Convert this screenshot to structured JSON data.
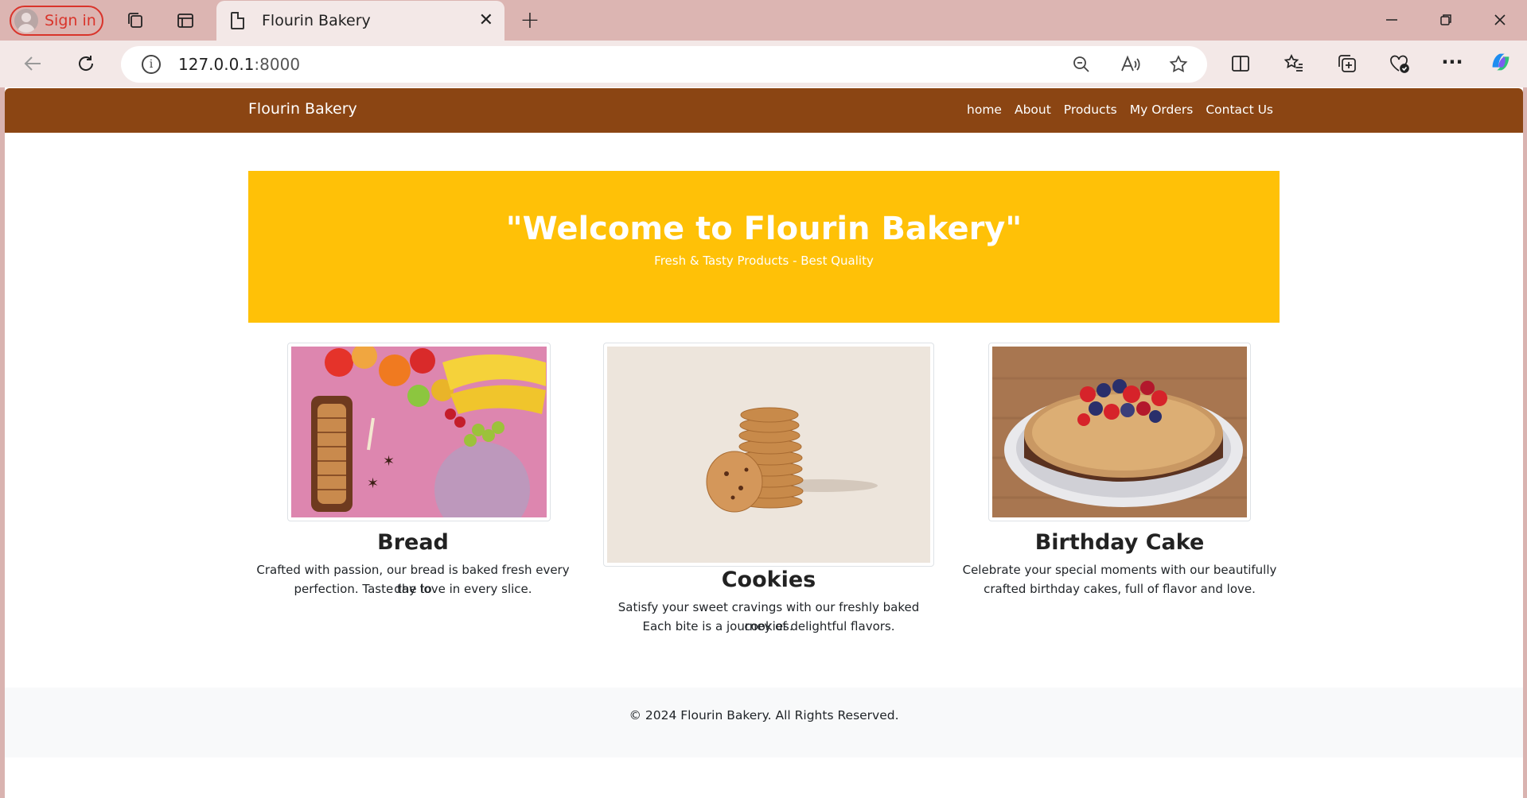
{
  "browser": {
    "signin_label": "Sign in",
    "tab_title": "Flourin Bakery",
    "url_host": "127.0.0.1",
    "url_port": ":8000"
  },
  "site": {
    "brand": "Flourin Bakery",
    "nav": [
      "home",
      "About",
      "Products",
      "My Orders",
      "Contact Us"
    ],
    "hero": {
      "title": "\"Welcome to Flourin Bakery\"",
      "subtitle": "Fresh & Tasty Products - Best Quality"
    },
    "cards": [
      {
        "title": "Bread",
        "desc_line1": "Crafted with passion, our bread is baked fresh every day to",
        "desc_line2": "perfection. Taste the love in every slice."
      },
      {
        "title": "Cookies",
        "desc_line1": "Satisfy your sweet cravings with our freshly baked cookies.",
        "desc_line2": "Each bite is a journey of delightful flavors."
      },
      {
        "title": "Birthday Cake",
        "desc_line1": "Celebrate your special moments with our beautifully",
        "desc_line2": "crafted birthday cakes, full of flavor and love."
      }
    ],
    "footer": "© 2024 Flourin Bakery. All Rights Reserved."
  },
  "colors": {
    "navbar": "#8b4513",
    "hero": "#ffc107",
    "tabbar": "#dcb5b2"
  }
}
